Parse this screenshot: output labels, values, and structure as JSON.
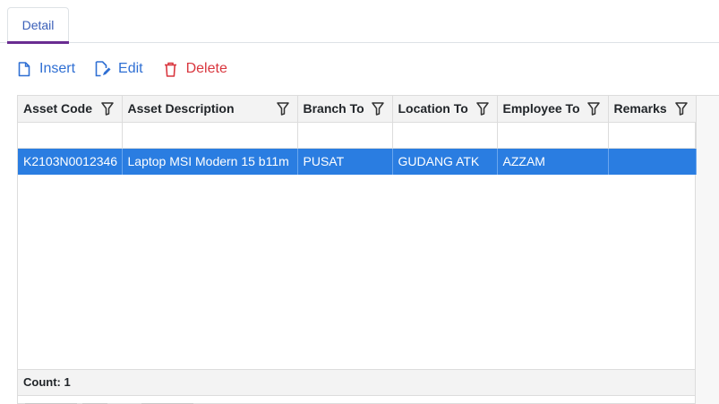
{
  "tabs": [
    {
      "label": "Detail"
    }
  ],
  "toolbar": {
    "insert": "Insert",
    "edit": "Edit",
    "delete": "Delete"
  },
  "colors": {
    "accent": "#2f6fd3",
    "danger": "#d9363e",
    "selected_row": "#2a7de1",
    "tab_underline": "#6a2c91"
  },
  "grid": {
    "columns": [
      "Asset Code",
      "Asset Description",
      "Branch To",
      "Location To",
      "Employee To",
      "Remarks"
    ],
    "rows": [
      [
        "K2103N0012346",
        "Laptop MSI Modern 15 b11m",
        "PUSAT",
        "GUDANG ATK",
        "AZZAM",
        ""
      ]
    ],
    "footer": "Count: 1"
  }
}
